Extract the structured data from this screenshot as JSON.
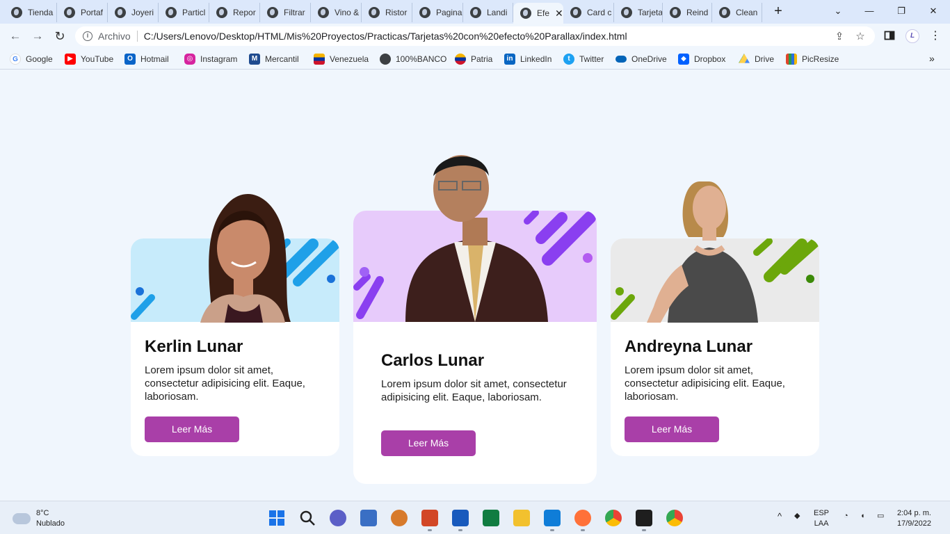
{
  "browser": {
    "tabs": [
      {
        "label": "Tienda"
      },
      {
        "label": "Portaf"
      },
      {
        "label": "Joyeri"
      },
      {
        "label": "Particl"
      },
      {
        "label": "Repor"
      },
      {
        "label": "Filtrar"
      },
      {
        "label": "Vino &"
      },
      {
        "label": "Ristor"
      },
      {
        "label": "Pagina"
      },
      {
        "label": "Landi"
      },
      {
        "label": "Efe"
      },
      {
        "label": "Card c"
      },
      {
        "label": "Tarjeta"
      },
      {
        "label": "Reind"
      },
      {
        "label": "Clean"
      }
    ],
    "new_tab_symbol": "+",
    "window_controls": {
      "collapse": "⌄",
      "minimize": "—",
      "restore": "❐",
      "close": "✕"
    },
    "omnibox": {
      "scheme_label": "Archivo",
      "url": "C:/Users/Lenovo/Desktop/HTML/Mis%20Proyectos/Practicas/Tarjetas%20con%20efecto%20Parallax/index.html"
    },
    "profile_initial": "L",
    "bookmarks": [
      {
        "label": "Google",
        "icon": "google-icon",
        "color": "#4285f4"
      },
      {
        "label": "YouTube",
        "icon": "youtube-icon",
        "color": "#ff0000"
      },
      {
        "label": "Hotmail",
        "icon": "outlook-icon",
        "color": "#0a64c8"
      },
      {
        "label": "Instagram",
        "icon": "instagram-icon",
        "color": "#d6249f"
      },
      {
        "label": "Mercantil",
        "icon": "mercantil-icon",
        "color": "#1f4b8f"
      },
      {
        "label": "Venezuela",
        "icon": "venezuela-icon",
        "color": "#f6b400"
      },
      {
        "label": "100%BANCO",
        "icon": "globe-icon",
        "color": "#3c4043"
      },
      {
        "label": "Patria",
        "icon": "patria-icon",
        "color": "#e63b2e"
      },
      {
        "label": "LinkedIn",
        "icon": "linkedin-icon",
        "color": "#0a66c2"
      },
      {
        "label": "Twitter",
        "icon": "twitter-icon",
        "color": "#1da1f2"
      },
      {
        "label": "OneDrive",
        "icon": "onedrive-icon",
        "color": "#0364b8"
      },
      {
        "label": "Dropbox",
        "icon": "dropbox-icon",
        "color": "#0061ff"
      },
      {
        "label": "Drive",
        "icon": "drive-icon",
        "color": "#1fa463"
      },
      {
        "label": "PicResize",
        "icon": "picresize-icon",
        "color": "#e0452b"
      }
    ]
  },
  "cards": [
    {
      "name": "Kerlin Lunar",
      "description": "Lorem ipsum dolor sit amet, consectetur adipisicing elit. Eaque, laboriosam.",
      "button": "Leer Más",
      "accent": "#1fa0e8",
      "header_bg": "#c7ebfb"
    },
    {
      "name": "Carlos Lunar",
      "description": "Lorem ipsum dolor sit amet, consectetur adipisicing elit. Eaque, laboriosam.",
      "button": "Leer Más",
      "accent": "#8a3ff0",
      "header_bg": "#e7cbfb"
    },
    {
      "name": "Andreyna Lunar",
      "description": "Lorem ipsum dolor sit amet, consectetur adipisicing elit. Eaque, laboriosam.",
      "button": "Leer Más",
      "accent": "#6ca70b",
      "header_bg": "#eaeaea"
    }
  ],
  "taskbar": {
    "weather": {
      "temp": "8°C",
      "condition": "Nublado"
    },
    "language": {
      "line1": "ESP",
      "line2": "LAA"
    },
    "clock": {
      "time": "2:04 p. m.",
      "date": "17/9/2022"
    }
  },
  "colors": {
    "button": "#a93fa8",
    "page_bg": "#f0f6fd"
  }
}
